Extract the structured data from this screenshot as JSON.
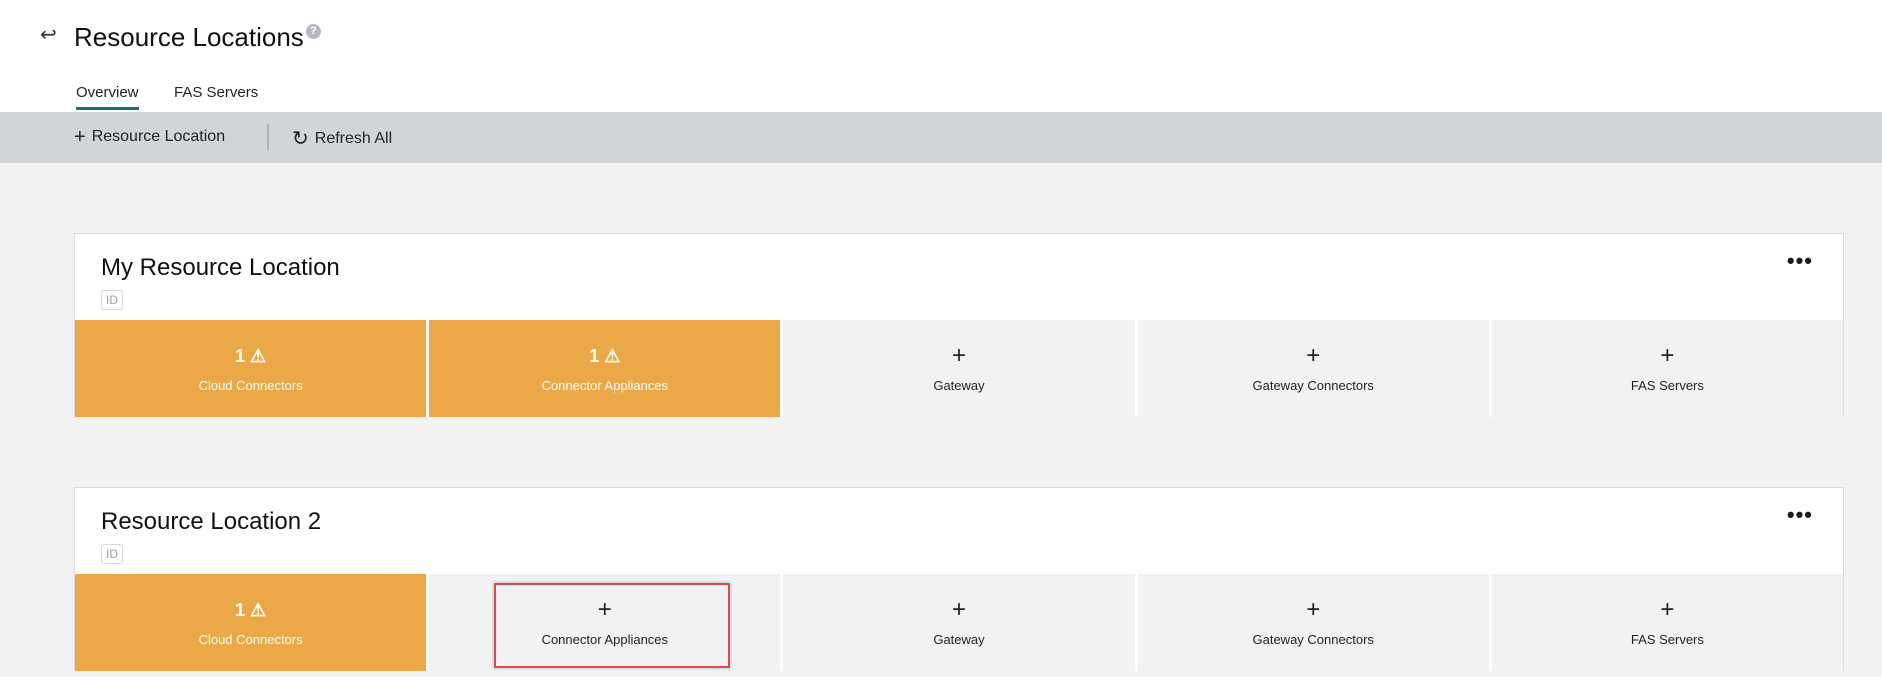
{
  "header": {
    "title": "Resource Locations",
    "back_icon": "↩",
    "help_icon": "?"
  },
  "tabs": [
    {
      "label": "Overview",
      "active": true
    },
    {
      "label": "FAS Servers",
      "active": false
    }
  ],
  "toolbar": {
    "add_label": "Resource Location",
    "refresh_label": "Refresh All"
  },
  "locations": [
    {
      "name": "My Resource Location",
      "id_badge": "ID",
      "menu": "•••",
      "tiles": [
        {
          "top": "1 ⚠",
          "label": "Cloud Connectors",
          "warn": true
        },
        {
          "top": "1 ⚠",
          "label": "Connector Appliances",
          "warn": true
        },
        {
          "top": "+",
          "label": "Gateway"
        },
        {
          "top": "+",
          "label": "Gateway Connectors"
        },
        {
          "top": "+",
          "label": "FAS Servers"
        }
      ]
    },
    {
      "name": "Resource Location 2",
      "id_badge": "ID",
      "menu": "•••",
      "tiles": [
        {
          "top": "1 ⚠",
          "label": "Cloud Connectors",
          "warn": true
        },
        {
          "top": "+",
          "label": "Connector Appliances"
        },
        {
          "top": "+",
          "label": "Gateway"
        },
        {
          "top": "+",
          "label": "Gateway Connectors"
        },
        {
          "top": "+",
          "label": "FAS Servers"
        }
      ]
    }
  ],
  "colors": {
    "warning": "#eca846",
    "tab_accent": "#16707a",
    "toolbar": "#d1d5d8",
    "highlight": "#e0474c"
  }
}
